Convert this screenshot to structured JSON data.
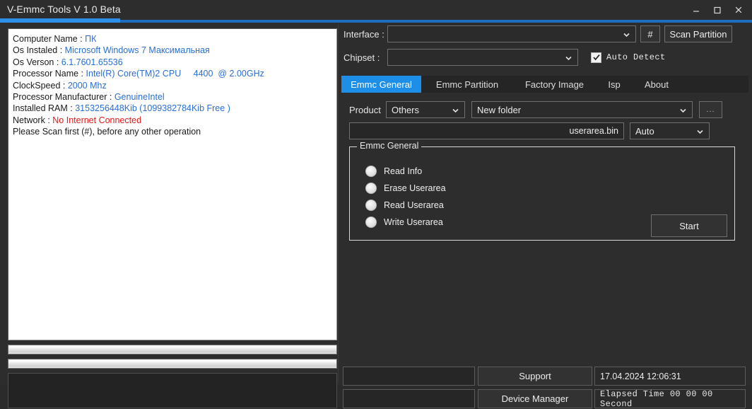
{
  "window": {
    "title": "V-Emmc Tools V 1.0 Beta",
    "accent_bright": "#2e8fe8",
    "accent_dark": "#1f6dbf",
    "minimize_icon": "minimize-icon",
    "maximize_icon": "maximize-icon",
    "close_icon": "close-icon"
  },
  "info_panel": {
    "lines": [
      {
        "key": "Computer Name : ",
        "value": "ПК",
        "color": "blue"
      },
      {
        "key": "Os Instaled : ",
        "value": "Microsoft Windows 7 Максимальная",
        "color": "blue"
      },
      {
        "key": "Os Verson : ",
        "value": "6.1.7601.65536",
        "color": "blue"
      },
      {
        "key": "Processor Name : ",
        "value": "Intel(R) Core(TM)2 CPU     4400  @ 2.00GHz",
        "color": "blue"
      },
      {
        "key": "ClockSpeed : ",
        "value": "2000 Mhz",
        "color": "blue"
      },
      {
        "key": "Processor Manufacturer : ",
        "value": "GenuineIntel",
        "color": "blue"
      },
      {
        "key": "Installed RAM : ",
        "value": "3153256448Kib (1099382784Kib Free )",
        "color": "blue"
      },
      {
        "key": "Network : ",
        "value": "No Internet Connected",
        "color": "red"
      },
      {
        "key": "Please Scan first (#), before any other operation",
        "value": "",
        "color": "plain"
      }
    ]
  },
  "progress": {
    "bar1_percent": 0,
    "bar2_percent": 0
  },
  "toolbar": {
    "interface_label": "Interface :",
    "interface_value": "",
    "hash_label": "#",
    "scan_label": "Scan Partition",
    "chipset_label": "Chipset :",
    "chipset_value": "",
    "auto_detect_label": "Auto  Detect",
    "auto_detect_checked": true
  },
  "tabs": [
    {
      "label": "Emmc General",
      "active": true
    },
    {
      "label": "Emmc Partition",
      "active": false
    },
    {
      "label": "Factory Image",
      "active": false
    },
    {
      "label": "Isp",
      "active": false
    },
    {
      "label": "About",
      "active": false
    }
  ],
  "general_tab": {
    "product_label": "Product",
    "product_value": "Others",
    "folder_value": "New folder",
    "browse_label": "...",
    "file_value": "userarea.bin",
    "mode_value": "Auto",
    "group_title": "Emmc General",
    "options": [
      {
        "label": "Read Info",
        "selected": false
      },
      {
        "label": "Erase Userarea",
        "selected": false
      },
      {
        "label": "Read Userarea",
        "selected": false
      },
      {
        "label": "Write Userarea",
        "selected": false
      }
    ],
    "start_label": "Start"
  },
  "status_bar": {
    "field1": "",
    "field2": "",
    "support_label": "Support",
    "device_manager_label": "Device Manager",
    "datetime": "17.04.2024 12:06:31",
    "elapsed": "Elapsed Time 00 00 00 Second"
  }
}
